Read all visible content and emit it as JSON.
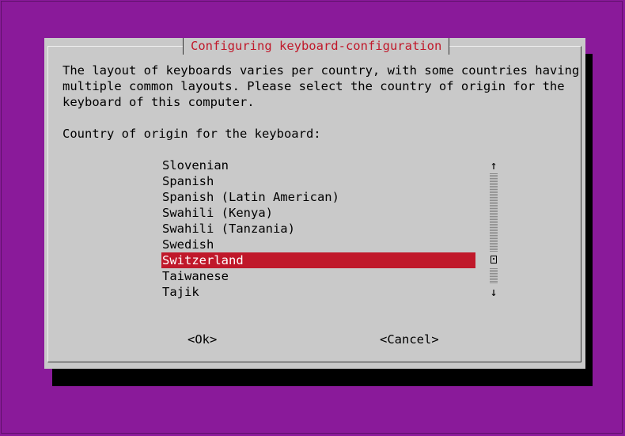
{
  "dialog": {
    "title": "Configuring keyboard-configuration",
    "description": "The layout of keyboards varies per country, with some countries having\nmultiple common layouts. Please select the country of origin for the\nkeyboard of this computer.",
    "prompt": "Country of origin for the keyboard:"
  },
  "list": {
    "items": [
      {
        "label": "Slovenian"
      },
      {
        "label": "Spanish"
      },
      {
        "label": "Spanish (Latin American)"
      },
      {
        "label": "Swahili (Kenya)"
      },
      {
        "label": "Swahili (Tanzania)"
      },
      {
        "label": "Swedish"
      },
      {
        "label": "Switzerland",
        "selected": true
      },
      {
        "label": "Taiwanese"
      },
      {
        "label": "Tajik"
      }
    ],
    "selected_index": 6
  },
  "scrollbar": {
    "up_arrow": "↑",
    "down_arrow": "↓"
  },
  "buttons": {
    "ok": "<Ok>",
    "cancel": "<Cancel>"
  },
  "colors": {
    "background": "#8a1a9a",
    "dialog": "#c9c9c9",
    "accent": "#c0182a"
  }
}
